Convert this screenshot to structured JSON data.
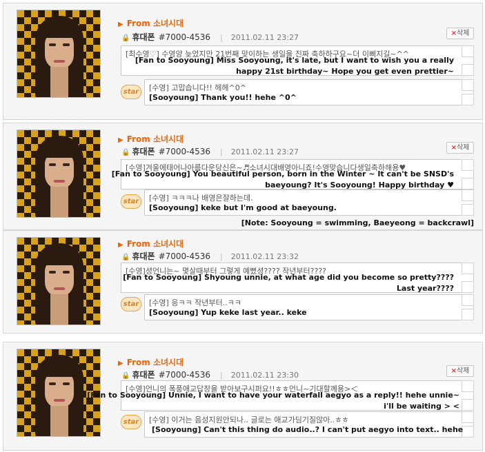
{
  "posts": [
    {
      "from_label": "From 소녀시대",
      "device": "휴대폰",
      "phone": "#7000-4536",
      "timestamp": "2011.02.11 23:27",
      "delete_label": "삭제",
      "fan_korean": "[최수영♡] 수영양 늦었지만 21번째 맞이하는 생일을 진짜 축하하구요~더 이뻐지길~^^",
      "fan_english": [
        "[Fan to Sooyoung] Miss Sooyoung, it's late, but I want to wish you a really",
        "happy 21st birthday~ Hope you get even prettier~"
      ],
      "reply_icon": "star",
      "reply_korean": "[수영] 고맙습니다!! 헤헤^0^",
      "reply_english": "[Sooyoung] Thank you!! hehe ^0^"
    },
    {
      "from_label": "From 소녀시대",
      "device": "휴대폰",
      "phone": "#7000-4536",
      "timestamp": "2011.02.11 23:27",
      "delete_label": "삭제",
      "fan_korean": "[수영]겨울에태어나아름다운당신은~♬소녀시대배영아니죠!수영맞습니다생일축하해용♥",
      "fan_english": [
        "[Fan to Sooyoung] You beautiful person, born in the Winter ~ It can't be SNSD's",
        "baeyoung? It's Sooyoung! Happy birthday ♥"
      ],
      "reply_icon": "star",
      "reply_korean": "[수영] ㅋㅋㅋ나 배영은잘하는데.",
      "reply_english": "[Sooyoung] keke but I'm good at baeyoung.",
      "note": "[Note: Sooyoung = swimming, Baeyeong = backcrawl]"
    },
    {
      "from_label": "From 소녀시대",
      "device": "휴대폰",
      "phone": "#7000-4536",
      "timestamp": "2011.02.11 23:32",
      "delete_label": "삭제",
      "fan_korean": "[수영]셩언니는~ 몇살때부터 그렇게 예뻤셩???? 작년부터????",
      "fan_english": [
        "[Fan to Sooyoung] Shyoung unnie, at what age did you become so pretty????",
        "Last year????"
      ],
      "reply_icon": "star",
      "reply_korean": "[수영] 응ㅋㅋ 작년부터..ㅋㅋ",
      "reply_english": "[Sooyoung] Yup keke last year.. keke"
    },
    {
      "from_label": "From 소녀시대",
      "device": "휴대폰",
      "phone": "#7000-4536",
      "timestamp": "2011.02.11 23:30",
      "delete_label": "삭제",
      "fan_korean": "[수영]언니의 폭풍애교답장을 받아보구시퍼요!!ㅎㅎ언니~기대할께용>＜",
      "fan_english": [
        "[Fan to Sooyoung] Unnie, I want to have your waterfall aegyo as a reply!! hehe unnie~",
        "i'll be waiting > <"
      ],
      "reply_icon": "star",
      "reply_korean": "[수영] 이거는 음성지원안되나.. 글로는 애교가딤기질않아..ㅎㅎ",
      "reply_english": "[Sooyoung] Can't this thing do audio..? I can't put aegyo into text.. hehe"
    }
  ]
}
